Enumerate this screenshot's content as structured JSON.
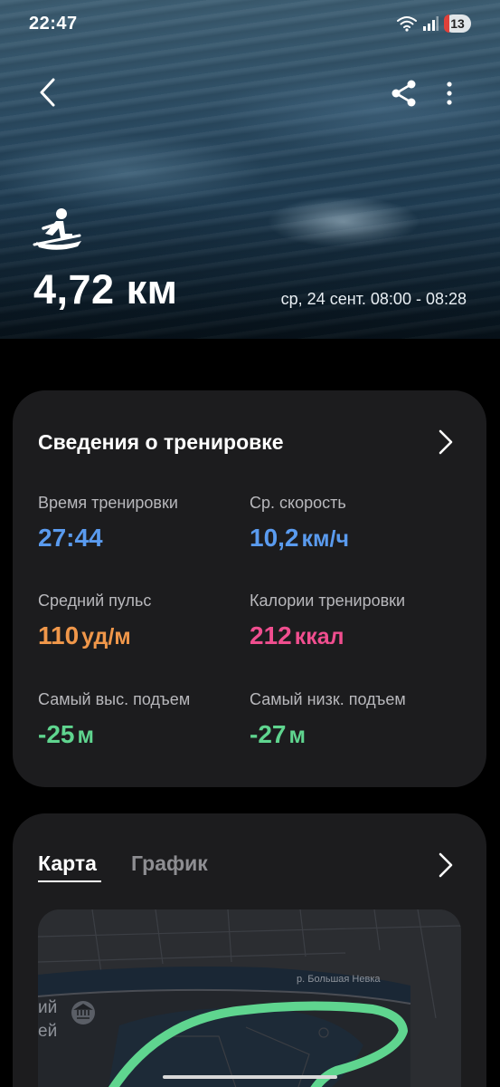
{
  "status_bar": {
    "time": "22:47",
    "battery_level": "13",
    "icons": [
      "wifi-icon",
      "signal-icon",
      "battery-icon"
    ]
  },
  "header": {
    "activity_icon": "rowing-icon",
    "distance": "4,72 км",
    "date_range": "ср, 24 сент. 08:00 - 08:28",
    "icons": [
      "back-icon",
      "share-icon",
      "more-icon"
    ]
  },
  "summary": {
    "title": "Сведения о тренировке",
    "metrics": [
      {
        "label": "Время тренировки",
        "value": "27:44",
        "unit": "",
        "color": "#5a9bef"
      },
      {
        "label": "Ср. скорость",
        "value": "10,2",
        "unit": "км/ч",
        "color": "#5a9bef"
      },
      {
        "label": "Средний пульс",
        "value": "110",
        "unit": "уд/м",
        "color": "#f0974a"
      },
      {
        "label": "Калории тренировки",
        "value": "212",
        "unit": "ккал",
        "color": "#f04e8f"
      },
      {
        "label": "Самый выс. подъем",
        "value": "-25",
        "unit": "м",
        "color": "#5fd58f"
      },
      {
        "label": "Самый низк. подъем",
        "value": "-27",
        "unit": "м",
        "color": "#5fd58f"
      }
    ]
  },
  "map_card": {
    "tabs": [
      {
        "label": "Карта",
        "active": true
      },
      {
        "label": "График",
        "active": false
      }
    ],
    "map": {
      "street_label": "р. Большая Невка",
      "edge_label_1": "ий",
      "edge_label_2": "ей",
      "route_color": "#5fd58f",
      "poi_icon": "museum-icon"
    }
  }
}
